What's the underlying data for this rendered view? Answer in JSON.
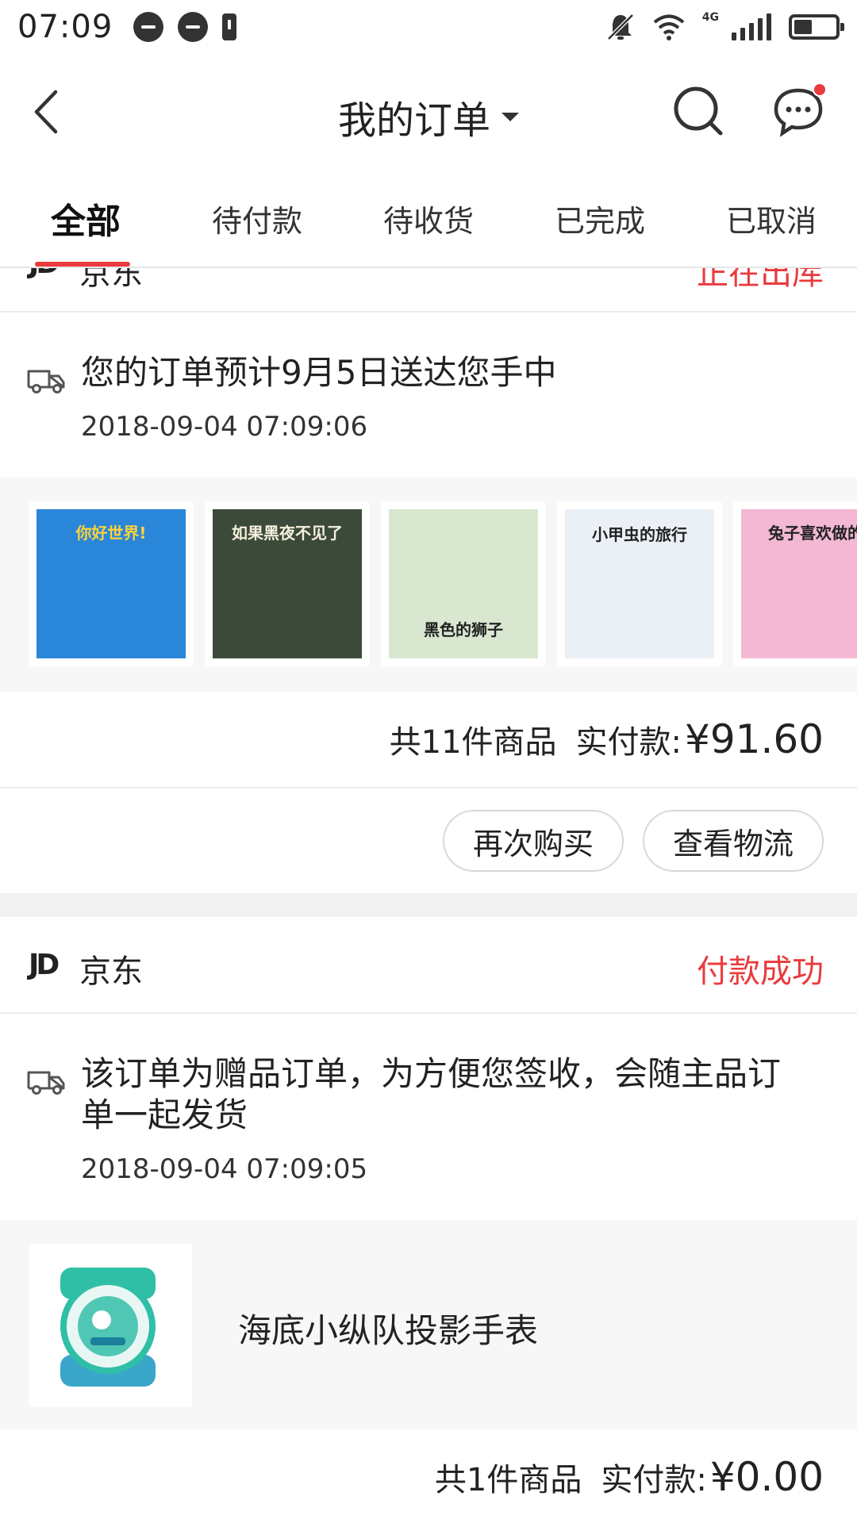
{
  "status_bar": {
    "time": "07:09",
    "network": "4G"
  },
  "nav": {
    "title": "我的订单"
  },
  "tabs": [
    {
      "label": "全部",
      "active": true
    },
    {
      "label": "待付款"
    },
    {
      "label": "待收货"
    },
    {
      "label": "已完成"
    },
    {
      "label": "已取消"
    }
  ],
  "orders": [
    {
      "shop_logo": "JD",
      "shop": "京东",
      "status": "正在出库",
      "delivery_message": "您的订单预计9月5日送达您手中",
      "delivery_time": "2018-09-04 07:09:06",
      "products": [
        {
          "title": "你好世界!",
          "color": "#2a86d8"
        },
        {
          "title": "如果黑夜不见了",
          "color": "#3c4a3a"
        },
        {
          "title": "黑色的狮子",
          "color": "#d9e6d0"
        },
        {
          "title": "小甲虫的旅行",
          "color": "#eaf0f6"
        },
        {
          "title": "兔子喜欢做的",
          "color": "#f2b8d4"
        }
      ],
      "item_count": "共11件商品",
      "paid_label": "实付款:",
      "amount": "¥91.60",
      "actions": {
        "rebuy": "再次购买",
        "logistics": "查看物流"
      }
    },
    {
      "shop_logo": "JD",
      "shop": "京东",
      "status": "付款成功",
      "delivery_message": "该订单为赠品订单，为方便您签收，会随主品订单一起发货",
      "delivery_time": "2018-09-04 07:09:05",
      "product_name": "海底小纵队投影手表",
      "item_count": "共1件商品",
      "paid_label": "实付款:",
      "amount": "¥0.00"
    }
  ],
  "colors": {
    "accent": "#e93b3d",
    "strip_bg": "#f7f7f7",
    "divider": "#ececec"
  }
}
